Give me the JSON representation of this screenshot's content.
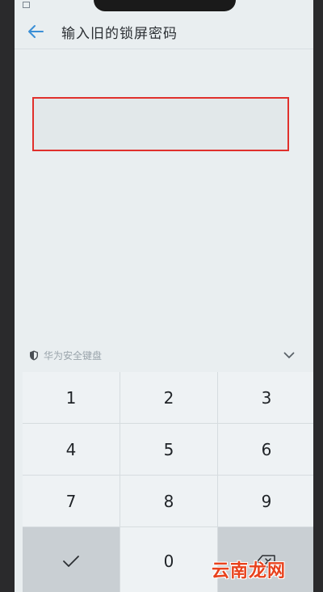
{
  "header": {
    "title": "输入旧的锁屏密码"
  },
  "password": {
    "value": ""
  },
  "keyboard": {
    "brand_label": "华为安全键盘",
    "keys": [
      "1",
      "2",
      "3",
      "4",
      "5",
      "6",
      "7",
      "8",
      "9",
      "0"
    ]
  },
  "watermark": {
    "text": "云南龙网"
  },
  "icons": {
    "back": "arrow-left-icon",
    "shield": "shield-icon",
    "collapse": "chevron-down-icon",
    "confirm": "checkmark-icon",
    "delete": "backspace-icon"
  },
  "colors": {
    "highlight_border": "#e0302c",
    "back_arrow": "#3a8fd6",
    "watermark": "#e8421d"
  }
}
